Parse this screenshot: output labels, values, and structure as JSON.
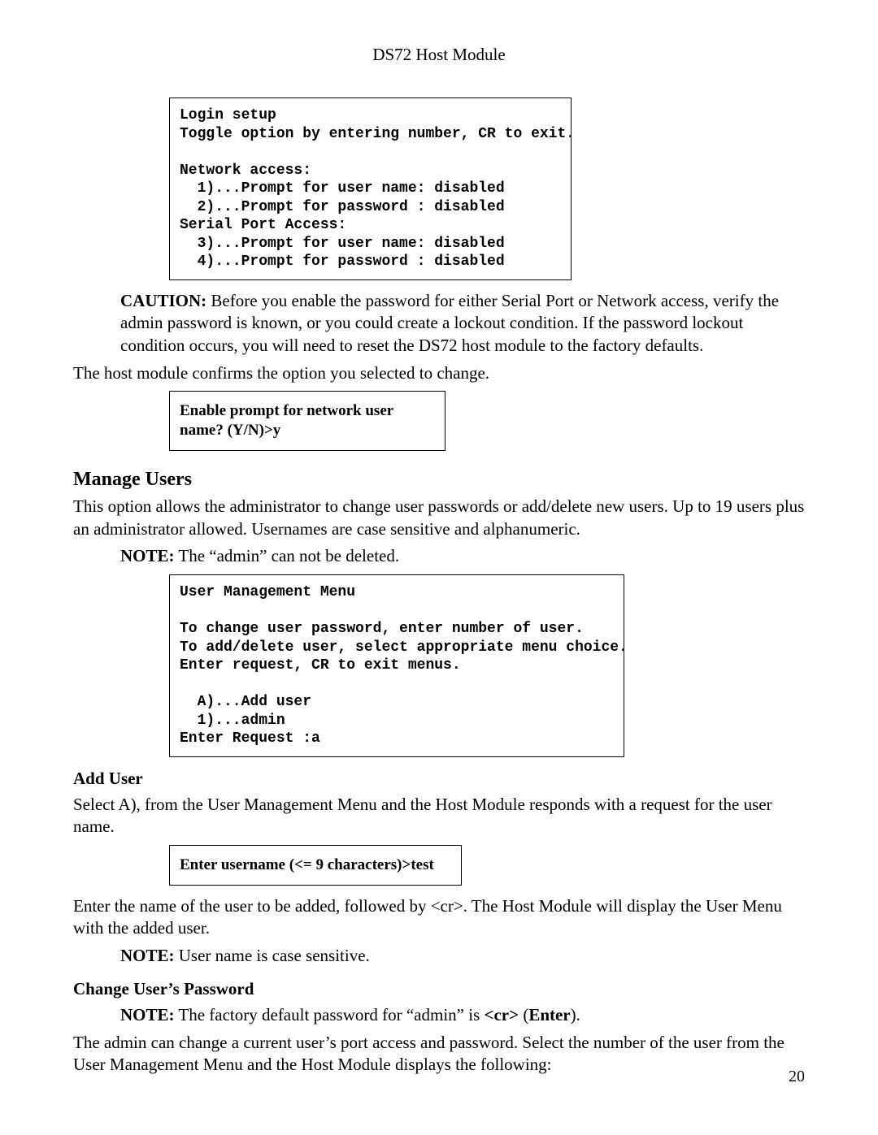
{
  "header": {
    "title": "DS72 Host Module"
  },
  "login_box": {
    "l1": "Login setup",
    "l2": "Toggle option by entering number, CR to exit.",
    "l3": "",
    "l4": "Network access:",
    "l5": "  1)...Prompt for user name: disabled",
    "l6": "  2)...Prompt for password : disabled",
    "l7": "Serial Port Access:",
    "l8": "  3)...Prompt for user name: disabled",
    "l9": "  4)...Prompt for password : disabled"
  },
  "caution": {
    "label": "CAUTION:",
    "text": " Before you enable the password for either Serial Port or Network access, verify the admin password is known, or you could create a lockout condition. If the password lockout condition occurs, you will need to reset the DS72 host module to the factory defaults."
  },
  "confirm_line": "The host module confirms the option you selected to change.",
  "enable_box": "Enable  prompt for network user name? (Y/N)>y",
  "manage_users": {
    "heading": "Manage Users",
    "para": "This option allows the administrator to change user passwords or add/delete new users. Up to 19 users plus an administrator allowed. Usernames are case sensitive and alphanumeric.",
    "note_label": "NOTE:",
    "note_text": " The “admin” can not be deleted."
  },
  "user_mgmt_box": {
    "l1": "User Management Menu",
    "l2": "",
    "l3": "To change user password, enter number of user.",
    "l4": "To add/delete user, select appropriate menu choice.",
    "l5": "Enter request, CR to exit menus.",
    "l6": "",
    "l7": "  A)...Add user",
    "l8": "  1)...admin",
    "l9": "Enter Request :a"
  },
  "add_user": {
    "heading": "Add User",
    "para": "Select A), from the User Management Menu and the Host Module responds with a request for the user name."
  },
  "username_box": "Enter username (<= 9 characters)>test",
  "add_user_after": "Enter the name of the user to be added, followed by <cr>. The Host Module will display the User Menu with the added user.",
  "note2_label": "NOTE:",
  "note2_text": " User name is case sensitive.",
  "change_pw": {
    "heading": "Change User’s Password",
    "note_label": "NOTE:",
    "note_text_a": " The factory default password for “admin” is ",
    "cr": "<cr>",
    "paren_open": " (",
    "enter": "Enter",
    "paren_close": ").",
    "para": "The admin can change a current user’s port access and password. Select the number of the user from the User Management Menu and the Host Module displays the following:"
  },
  "page_number": "20"
}
